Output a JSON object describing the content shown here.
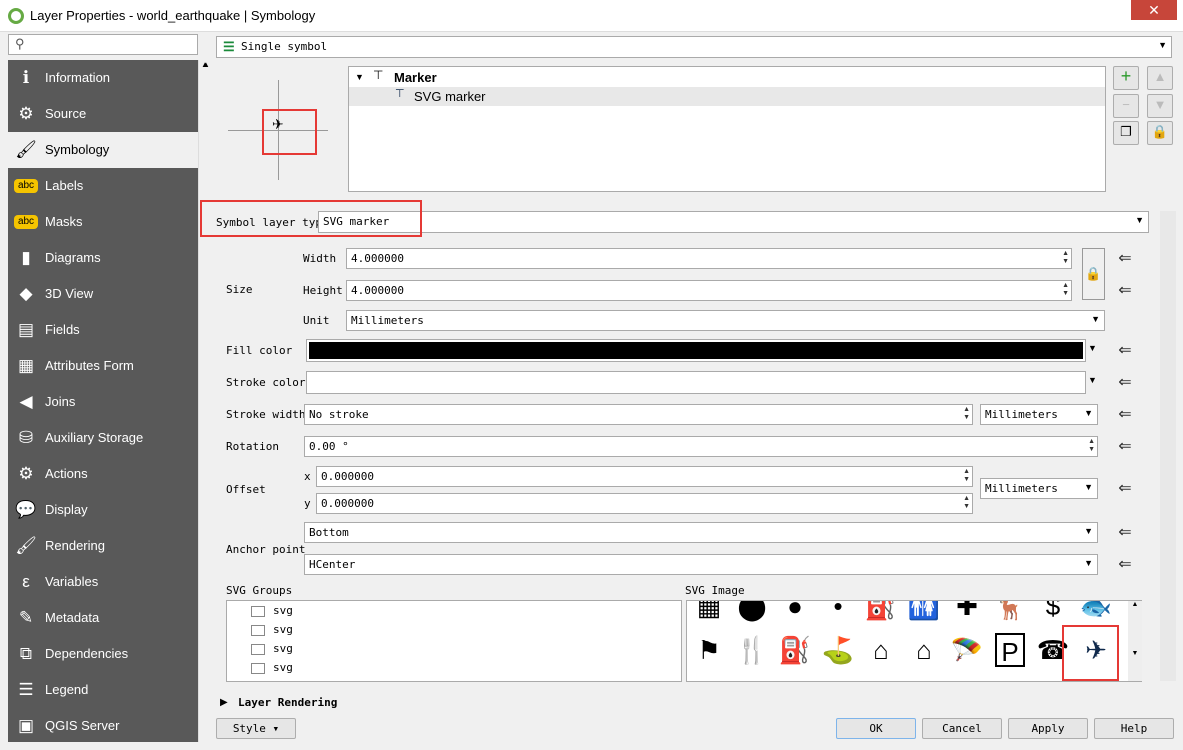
{
  "window": {
    "title": "Layer Properties - world_earthquake | Symbology",
    "close_icon": "close-icon"
  },
  "sidebar": {
    "search_placeholder": "",
    "items": [
      {
        "label": "Information",
        "icon": "info-icon",
        "glyph": "ℹ"
      },
      {
        "label": "Source",
        "icon": "source-wrench-icon",
        "glyph": "⚙"
      },
      {
        "label": "Symbology",
        "icon": "symbology-brush-icon",
        "glyph": "🖌",
        "active": true
      },
      {
        "label": "Labels",
        "icon": "labels-abc-icon",
        "glyph": "abc"
      },
      {
        "label": "Masks",
        "icon": "masks-abc-icon",
        "glyph": "abc"
      },
      {
        "label": "Diagrams",
        "icon": "diagrams-icon",
        "glyph": "▮"
      },
      {
        "label": "3D View",
        "icon": "3d-cube-icon",
        "glyph": "◆"
      },
      {
        "label": "Fields",
        "icon": "fields-icon",
        "glyph": "▤"
      },
      {
        "label": "Attributes Form",
        "icon": "attributes-form-icon",
        "glyph": "▦"
      },
      {
        "label": "Joins",
        "icon": "joins-icon",
        "glyph": "◀"
      },
      {
        "label": "Auxiliary Storage",
        "icon": "auxiliary-storage-icon",
        "glyph": "⛁"
      },
      {
        "label": "Actions",
        "icon": "actions-gear-icon",
        "glyph": "⚙"
      },
      {
        "label": "Display",
        "icon": "display-speech-icon",
        "glyph": "💬"
      },
      {
        "label": "Rendering",
        "icon": "rendering-brush-icon",
        "glyph": "🖌"
      },
      {
        "label": "Variables",
        "icon": "variables-epsilon-icon",
        "glyph": "ε"
      },
      {
        "label": "Metadata",
        "icon": "metadata-icon",
        "glyph": "✎"
      },
      {
        "label": "Dependencies",
        "icon": "dependencies-icon",
        "glyph": "⧉"
      },
      {
        "label": "Legend",
        "icon": "legend-icon",
        "glyph": "☰"
      },
      {
        "label": "QGIS Server",
        "icon": "qgis-server-icon",
        "glyph": "▣"
      }
    ]
  },
  "renderer": {
    "value": "Single symbol"
  },
  "symbol_tree": {
    "root": "Marker",
    "child": "SVG marker"
  },
  "symbol_layer_type": {
    "label": "Symbol layer type",
    "value": "SVG marker"
  },
  "size": {
    "label": "Size",
    "width_label": "Width",
    "width": "4.000000",
    "height_label": "Height",
    "height": "4.000000",
    "unit_label": "Unit",
    "unit": "Millimeters"
  },
  "fill_color": {
    "label": "Fill color",
    "color": "#000000"
  },
  "stroke_color": {
    "label": "Stroke color",
    "color": "#ffffff"
  },
  "stroke_width": {
    "label": "Stroke width",
    "value": "No stroke",
    "unit": "Millimeters"
  },
  "rotation": {
    "label": "Rotation",
    "value": "0.00 °"
  },
  "offset": {
    "label": "Offset",
    "x_label": "x",
    "x": "0.000000",
    "y_label": "y",
    "y": "0.000000",
    "unit": "Millimeters"
  },
  "anchor": {
    "label": "Anchor point",
    "vertical": "Bottom",
    "horizontal": "HCenter"
  },
  "svg_groups": {
    "label": "SVG Groups",
    "items": [
      "svg",
      "svg",
      "svg",
      "svg"
    ]
  },
  "svg_image": {
    "label": "SVG Image",
    "row1": [
      "▦",
      "⬤",
      "●",
      "•",
      "⛽",
      "🚻",
      "✚",
      "🦌",
      "$",
      "🐟"
    ],
    "row2": [
      "⚑",
      "🍴",
      "⛽",
      "⛳",
      "⌂",
      "⌂",
      "🪂",
      "P",
      "☎",
      "✈"
    ]
  },
  "layer_rendering": {
    "label": "Layer Rendering"
  },
  "buttons": {
    "style": "Style",
    "ok": "OK",
    "cancel": "Cancel",
    "apply": "Apply",
    "help": "Help"
  },
  "colors": {
    "sidebar_bg": "#595959",
    "highlight": "#e53935",
    "selected_icon": "#102a4c"
  }
}
